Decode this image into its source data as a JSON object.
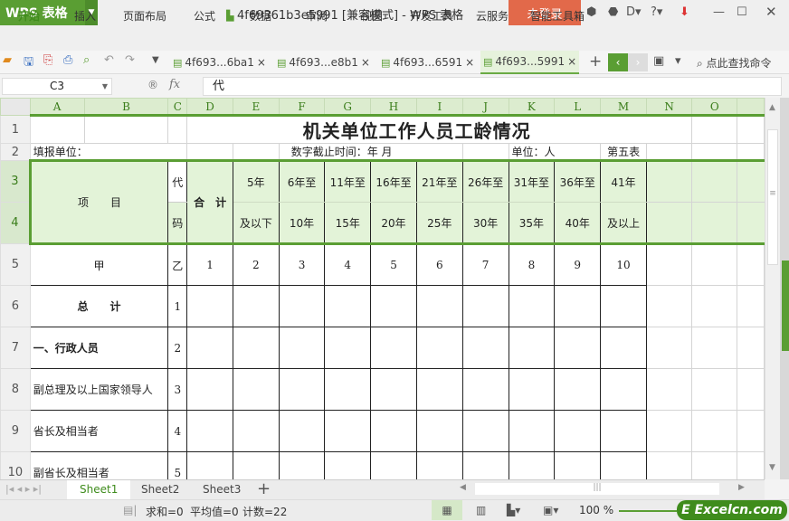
{
  "app": {
    "logo": "WPS 表格",
    "window_title": "4f69361b3e5991 [兼容模式] - WPS 表格",
    "login": "未登录"
  },
  "menu": [
    "开始",
    "插入",
    "页面布局",
    "公式",
    "数据",
    "审阅",
    "视图",
    "开发工具",
    "云服务",
    "智能工具箱"
  ],
  "doc_tabs": [
    "4f693...6ba1",
    "4f693...e8b1",
    "4f693...6591",
    "4f693...5991"
  ],
  "search_cmd": "点此查找命令",
  "formula": {
    "name_box": "C3",
    "fx": "fx",
    "value": "代"
  },
  "columns": [
    "A",
    "B",
    "C",
    "D",
    "E",
    "F",
    "G",
    "H",
    "I",
    "J",
    "K",
    "L",
    "M",
    "N",
    "O",
    ""
  ],
  "rows": [
    "1",
    "2",
    "3",
    "4",
    "5",
    "6",
    "7",
    "8",
    "9",
    "10"
  ],
  "sheet": {
    "title": "机关单位工作人员工龄情况",
    "fill_unit": "填报单位：",
    "deadline": "数字截止时间：年  月",
    "unit": "单位：人",
    "table_no": "第五表",
    "item": "项　　目",
    "code_top": "代",
    "code_bottom": "码",
    "total": "合　计",
    "ranges_top": [
      "5年",
      "6年至",
      "11年至",
      "16年至",
      "21年至",
      "26年至",
      "31年至",
      "36年至",
      "41年"
    ],
    "ranges_bottom": [
      "及以下",
      "10年",
      "15年",
      "20年",
      "25年",
      "30年",
      "35年",
      "40年",
      "及以上"
    ],
    "row5": {
      "item": "甲",
      "code": "乙",
      "nums": [
        "1",
        "2",
        "3",
        "4",
        "5",
        "6",
        "7",
        "8",
        "9",
        "10"
      ]
    },
    "items": [
      {
        "label": "总　　计",
        "code": "1",
        "bold": true
      },
      {
        "label": "一、行政人员",
        "code": "2",
        "bold": true
      },
      {
        "label": "副总理及以上国家领导人",
        "code": "3"
      },
      {
        "label": "省长及相当者",
        "code": "4"
      },
      {
        "label": "副省长及相当者",
        "code": "5"
      }
    ]
  },
  "sheet_tabs": [
    "Sheet1",
    "Sheet2",
    "Sheet3"
  ],
  "status": {
    "sum": "求和=0",
    "avg": "平均值=0",
    "count": "计数=22",
    "zoom": "100 %"
  },
  "watermark": "Excelcn.com"
}
